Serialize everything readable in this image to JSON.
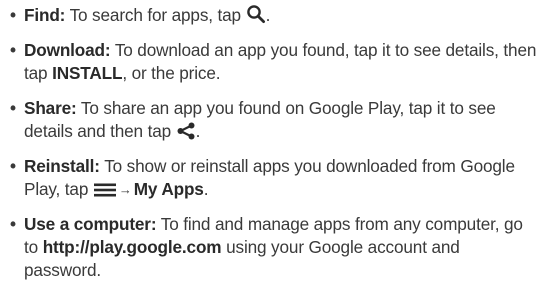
{
  "tips": [
    {
      "term": "Find:",
      "text_1": "To search for apps, tap",
      "icon": "search-icon",
      "text_2": "."
    },
    {
      "term": "Download:",
      "text_1": "To download an app you found, tap it to see details, then tap",
      "action": "INSTALL",
      "text_2": ", or the price."
    },
    {
      "term": "Share:",
      "text_1": "To share an app you found on Google Play, tap it to see details and then tap",
      "icon": "share-icon",
      "text_2": "."
    },
    {
      "term": "Reinstall:",
      "text_1": "To show or reinstall apps you downloaded from Google Play, tap",
      "icon": "menu-icon",
      "arrow": "→",
      "target": "My Apps",
      "text_2": "."
    },
    {
      "term": "Use a computer:",
      "text_1": "To find and manage apps from any computer, go to",
      "link": "http://play.google.com",
      "text_2": "using your Google account and password."
    }
  ],
  "bullet": "•",
  "colors": {
    "text": "#3a3a3a",
    "icon": "#2a2a2a"
  }
}
